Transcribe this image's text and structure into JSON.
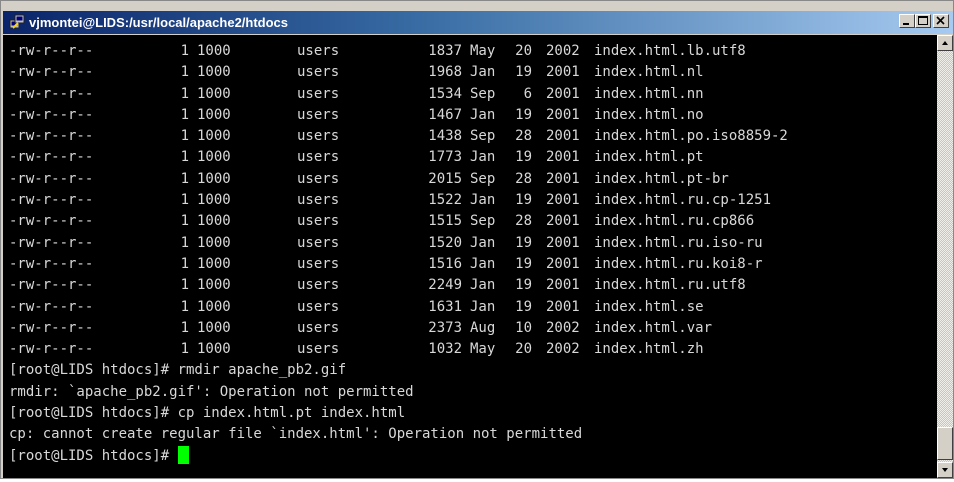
{
  "window": {
    "title": "vjmontei@LIDS:/usr/local/apache2/htdocs",
    "icon": "putty-terminal-icon",
    "buttons": [
      "minimize",
      "maximize",
      "close"
    ]
  },
  "terminal": {
    "listing": [
      {
        "perm": "-rw-r--r--",
        "links": "1",
        "owner": "1000",
        "group": "users",
        "size": "1837",
        "month": "May",
        "day": "20",
        "year": "2002",
        "name": "index.html.lb.utf8"
      },
      {
        "perm": "-rw-r--r--",
        "links": "1",
        "owner": "1000",
        "group": "users",
        "size": "1968",
        "month": "Jan",
        "day": "19",
        "year": "2001",
        "name": "index.html.nl"
      },
      {
        "perm": "-rw-r--r--",
        "links": "1",
        "owner": "1000",
        "group": "users",
        "size": "1534",
        "month": "Sep",
        "day": "6",
        "year": "2001",
        "name": "index.html.nn"
      },
      {
        "perm": "-rw-r--r--",
        "links": "1",
        "owner": "1000",
        "group": "users",
        "size": "1467",
        "month": "Jan",
        "day": "19",
        "year": "2001",
        "name": "index.html.no"
      },
      {
        "perm": "-rw-r--r--",
        "links": "1",
        "owner": "1000",
        "group": "users",
        "size": "1438",
        "month": "Sep",
        "day": "28",
        "year": "2001",
        "name": "index.html.po.iso8859-2"
      },
      {
        "perm": "-rw-r--r--",
        "links": "1",
        "owner": "1000",
        "group": "users",
        "size": "1773",
        "month": "Jan",
        "day": "19",
        "year": "2001",
        "name": "index.html.pt"
      },
      {
        "perm": "-rw-r--r--",
        "links": "1",
        "owner": "1000",
        "group": "users",
        "size": "2015",
        "month": "Sep",
        "day": "28",
        "year": "2001",
        "name": "index.html.pt-br"
      },
      {
        "perm": "-rw-r--r--",
        "links": "1",
        "owner": "1000",
        "group": "users",
        "size": "1522",
        "month": "Jan",
        "day": "19",
        "year": "2001",
        "name": "index.html.ru.cp-1251"
      },
      {
        "perm": "-rw-r--r--",
        "links": "1",
        "owner": "1000",
        "group": "users",
        "size": "1515",
        "month": "Sep",
        "day": "28",
        "year": "2001",
        "name": "index.html.ru.cp866"
      },
      {
        "perm": "-rw-r--r--",
        "links": "1",
        "owner": "1000",
        "group": "users",
        "size": "1520",
        "month": "Jan",
        "day": "19",
        "year": "2001",
        "name": "index.html.ru.iso-ru"
      },
      {
        "perm": "-rw-r--r--",
        "links": "1",
        "owner": "1000",
        "group": "users",
        "size": "1516",
        "month": "Jan",
        "day": "19",
        "year": "2001",
        "name": "index.html.ru.koi8-r"
      },
      {
        "perm": "-rw-r--r--",
        "links": "1",
        "owner": "1000",
        "group": "users",
        "size": "2249",
        "month": "Jan",
        "day": "19",
        "year": "2001",
        "name": "index.html.ru.utf8"
      },
      {
        "perm": "-rw-r--r--",
        "links": "1",
        "owner": "1000",
        "group": "users",
        "size": "1631",
        "month": "Jan",
        "day": "19",
        "year": "2001",
        "name": "index.html.se"
      },
      {
        "perm": "-rw-r--r--",
        "links": "1",
        "owner": "1000",
        "group": "users",
        "size": "2373",
        "month": "Aug",
        "day": "10",
        "year": "2002",
        "name": "index.html.var"
      },
      {
        "perm": "-rw-r--r--",
        "links": "1",
        "owner": "1000",
        "group": "users",
        "size": "1032",
        "month": "May",
        "day": "20",
        "year": "2002",
        "name": "index.html.zh"
      }
    ],
    "output_lines": [
      "[root@LIDS htdocs]# rmdir apache_pb2.gif",
      "rmdir: `apache_pb2.gif': Operation not permitted",
      "[root@LIDS htdocs]# cp index.html.pt index.html",
      "cp: cannot create regular file `index.html': Operation not permitted"
    ],
    "prompt": "[root@LIDS htdocs]# ",
    "colors": {
      "background": "#000000",
      "text": "#d8d8d8",
      "cursor": "#00ff00"
    }
  }
}
